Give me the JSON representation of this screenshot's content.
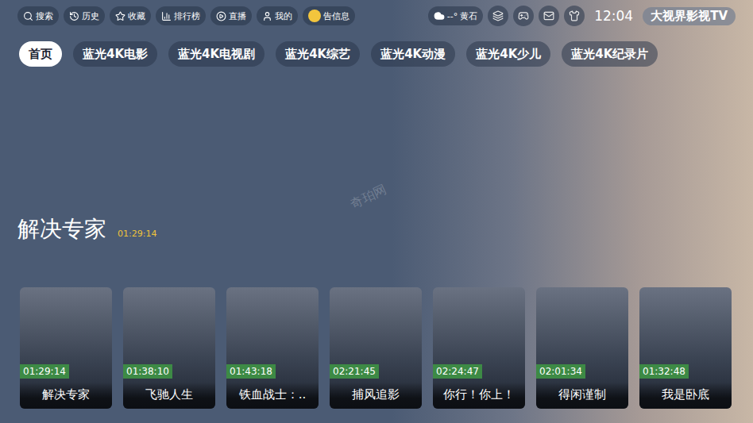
{
  "top_bar": {
    "buttons": [
      {
        "label": "搜索"
      },
      {
        "label": "历史"
      },
      {
        "label": "收藏"
      },
      {
        "label": "排行榜"
      },
      {
        "label": "直播"
      },
      {
        "label": "我的"
      }
    ],
    "notice": "告信息",
    "weather": {
      "temp": "--°",
      "city": "黄石"
    },
    "time": "12:04",
    "app_name": "大视界影视TV"
  },
  "tabs": [
    {
      "label": "首页",
      "selected": true
    },
    {
      "label": "蓝光4K电影",
      "selected": false
    },
    {
      "label": "蓝光4K电视剧",
      "selected": false
    },
    {
      "label": "蓝光4K综艺",
      "selected": false
    },
    {
      "label": "蓝光4K动漫",
      "selected": false
    },
    {
      "label": "蓝光4K少儿",
      "selected": false
    },
    {
      "label": "蓝光4K纪录片",
      "selected": false
    }
  ],
  "featured": {
    "title": "解决专家",
    "duration": "01:29:14"
  },
  "cards": [
    {
      "title": "解决专家",
      "duration": "01:29:14"
    },
    {
      "title": "飞驰人生",
      "duration": "01:38:10"
    },
    {
      "title": "铁血战士：..",
      "duration": "01:43:18"
    },
    {
      "title": "捕风追影",
      "duration": "02:21:45"
    },
    {
      "title": "你行！你上！",
      "duration": "02:24:47"
    },
    {
      "title": "得闲谨制",
      "duration": "02:01:34"
    },
    {
      "title": "我是卧底",
      "duration": "01:32:48"
    }
  ],
  "watermark": "奇珀网"
}
